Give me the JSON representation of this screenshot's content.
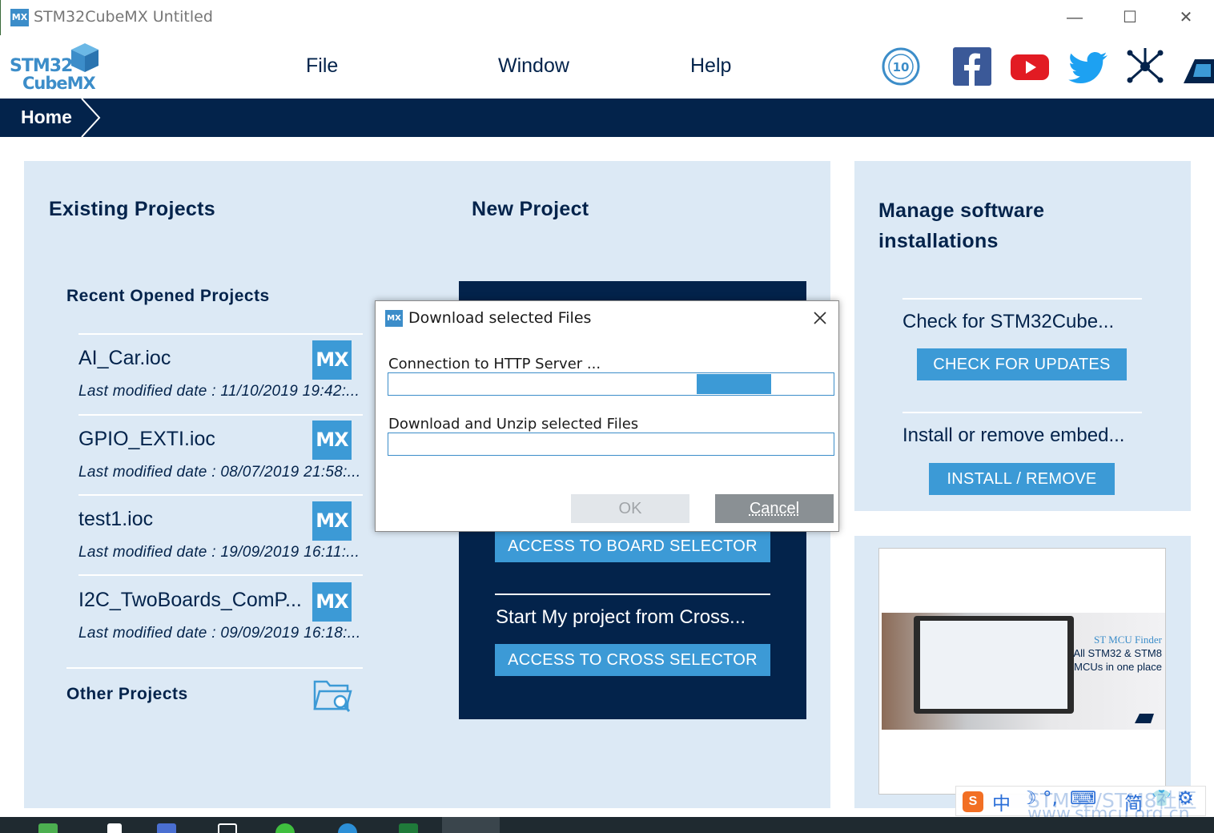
{
  "window": {
    "app_icon_text": "MX",
    "title": "STM32CubeMX Untitled",
    "minimize": "—",
    "maximize": "☐",
    "close": "✕"
  },
  "logo": {
    "line1": "STM32",
    "line2": "CubeMX"
  },
  "menu": {
    "file": "File",
    "window": "Window",
    "help": "Help"
  },
  "nav": {
    "home": "Home"
  },
  "existing": {
    "title": "Existing Projects",
    "recent_title": "Recent Opened Projects",
    "badge": "MX",
    "projects": [
      {
        "name": "AI_Car.ioc",
        "date": "Last modified date : 11/10/2019 19:42:..."
      },
      {
        "name": "GPIO_EXTI.ioc",
        "date": "Last modified date : 08/07/2019 21:58:..."
      },
      {
        "name": "test1.ioc",
        "date": "Last modified date : 19/09/2019 16:11:..."
      },
      {
        "name": "I2C_TwoBoards_ComP...",
        "date": "Last modified date : 09/09/2019 16:18:..."
      }
    ],
    "other_title": "Other Projects"
  },
  "new_project": {
    "title": "New Project",
    "board_button": "ACCESS TO BOARD SELECTOR",
    "cross_text": "Start My project from Cross...",
    "cross_button": "ACCESS TO CROSS SELECTOR"
  },
  "manage": {
    "title_line1": "Manage software",
    "title_line2": "installations",
    "check_text": "Check for STM32Cube...",
    "check_button": "CHECK FOR UPDATES",
    "install_text": "Install or remove embed...",
    "install_button": "INSTALL / REMOVE"
  },
  "ad": {
    "title": "ST MCU Finder",
    "line1": "All STM32 & STM8",
    "line2": "MCUs in one place"
  },
  "dialog": {
    "icon_text": "MX",
    "title": "Download selected Files",
    "connection_label": "Connection to HTTP Server ...",
    "unzip_label": "Download and Unzip selected Files",
    "ok": "OK",
    "cancel": "Cancel"
  },
  "ime": {
    "s_label": "S",
    "lang": "中",
    "moon": "☽",
    "punct": "°,",
    "keyboard": "⌨",
    "simplified": "简",
    "shirt": "👕",
    "gear": "⚙"
  },
  "watermark": {
    "line1": "STM32/STM8社区",
    "line2": "www.stmcu.org.cn"
  },
  "colors": {
    "navy": "#03234b",
    "accent_blue": "#3c9ad6",
    "panel_bg": "#dce9f5"
  }
}
